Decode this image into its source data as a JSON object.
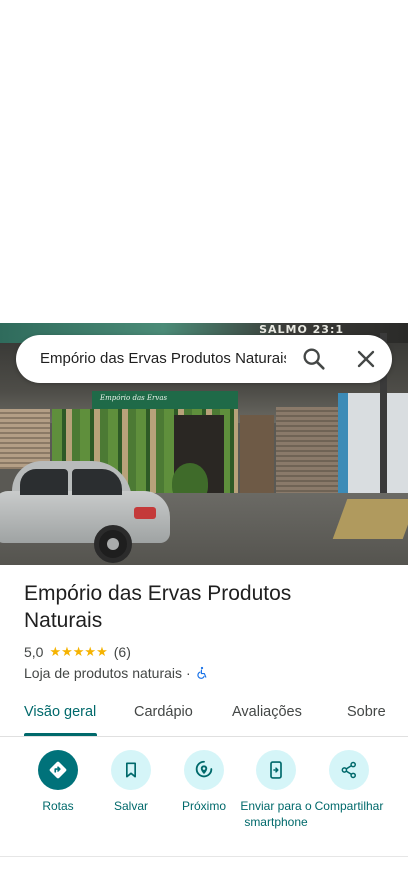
{
  "search": {
    "value": "Empório das Ervas Produtos Naturais"
  },
  "photo": {
    "sign_text": "SALMO 23:1",
    "awning_text": "Empório das Ervas"
  },
  "place": {
    "title": "Empório das Ervas Produtos Naturais",
    "rating": "5,0",
    "stars": "★★★★★",
    "review_count": "(6)",
    "category": "Loja de produtos naturais",
    "separator": "·"
  },
  "tabs": [
    {
      "label": "Visão geral",
      "active": true
    },
    {
      "label": "Cardápio",
      "active": false
    },
    {
      "label": "Avaliações",
      "active": false
    },
    {
      "label": "Sobre",
      "active": false
    }
  ],
  "actions": [
    {
      "label": "Rotas",
      "icon": "directions-icon",
      "primary": true
    },
    {
      "label": "Salvar",
      "icon": "bookmark-icon",
      "primary": false
    },
    {
      "label": "Próximo",
      "icon": "nearby-icon",
      "primary": false
    },
    {
      "label": "Enviar para o smartphone",
      "icon": "send-to-phone-icon",
      "primary": false
    },
    {
      "label": "Compartilhar",
      "icon": "share-icon",
      "primary": false
    }
  ],
  "colors": {
    "accent": "#00696b",
    "primary_button": "#00727a",
    "tonal_button": "#d5f5f8",
    "star": "#f5b301",
    "accessibility": "#1a73e8"
  }
}
